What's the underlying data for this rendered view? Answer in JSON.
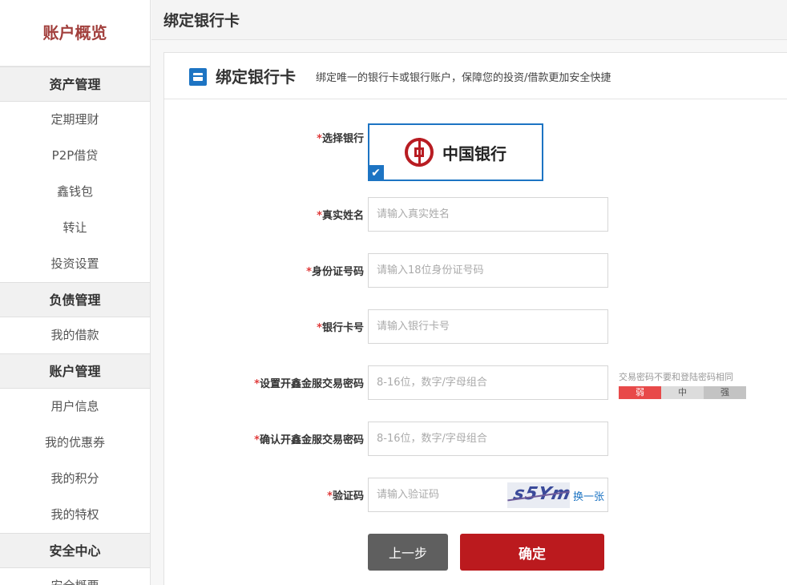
{
  "sidebar": {
    "title": "账户概览",
    "groups": [
      {
        "label": "资产管理",
        "items": [
          "定期理财",
          "P2P借贷",
          "鑫钱包",
          "转让",
          "投资设置"
        ]
      },
      {
        "label": "负债管理",
        "items": [
          "我的借款"
        ]
      },
      {
        "label": "账户管理",
        "items": [
          "用户信息",
          "我的优惠券",
          "我的积分",
          "我的特权"
        ]
      },
      {
        "label": "安全中心",
        "items": [
          "安全概要"
        ]
      }
    ]
  },
  "header": {
    "title": "绑定银行卡"
  },
  "panel": {
    "title": "绑定银行卡",
    "description": "绑定唯一的银行卡或银行账户，保障您的投资/借款更加安全快捷"
  },
  "form": {
    "bank": {
      "label": "选择银行",
      "selected": "中国银行",
      "check": "✔"
    },
    "name": {
      "label": "真实姓名",
      "placeholder": "请输入真实姓名",
      "value": ""
    },
    "id_number": {
      "label": "身份证号码",
      "placeholder": "请输入18位身份证号码",
      "value": ""
    },
    "card_number": {
      "label": "银行卡号",
      "placeholder": "请输入银行卡号",
      "value": ""
    },
    "trade_password": {
      "label": "设置开鑫金服交易密码",
      "placeholder": "8-16位，数字/字母组合",
      "hint": "交易密码不要和登陆密码相同",
      "strength_levels": [
        "弱",
        "中",
        "强"
      ]
    },
    "confirm_password": {
      "label": "确认开鑫金服交易密码",
      "placeholder": "8-16位，数字/字母组合"
    },
    "captcha": {
      "label": "验证码",
      "placeholder": "请输入验证码",
      "image_text": "s5Ym",
      "refresh": "换一张"
    },
    "required_mark": "*"
  },
  "buttons": {
    "prev": "上一步",
    "confirm": "确定"
  },
  "colors": {
    "brand_red": "#bb1a1e",
    "accent_blue": "#1d74c3",
    "title_red": "#a2403d"
  }
}
